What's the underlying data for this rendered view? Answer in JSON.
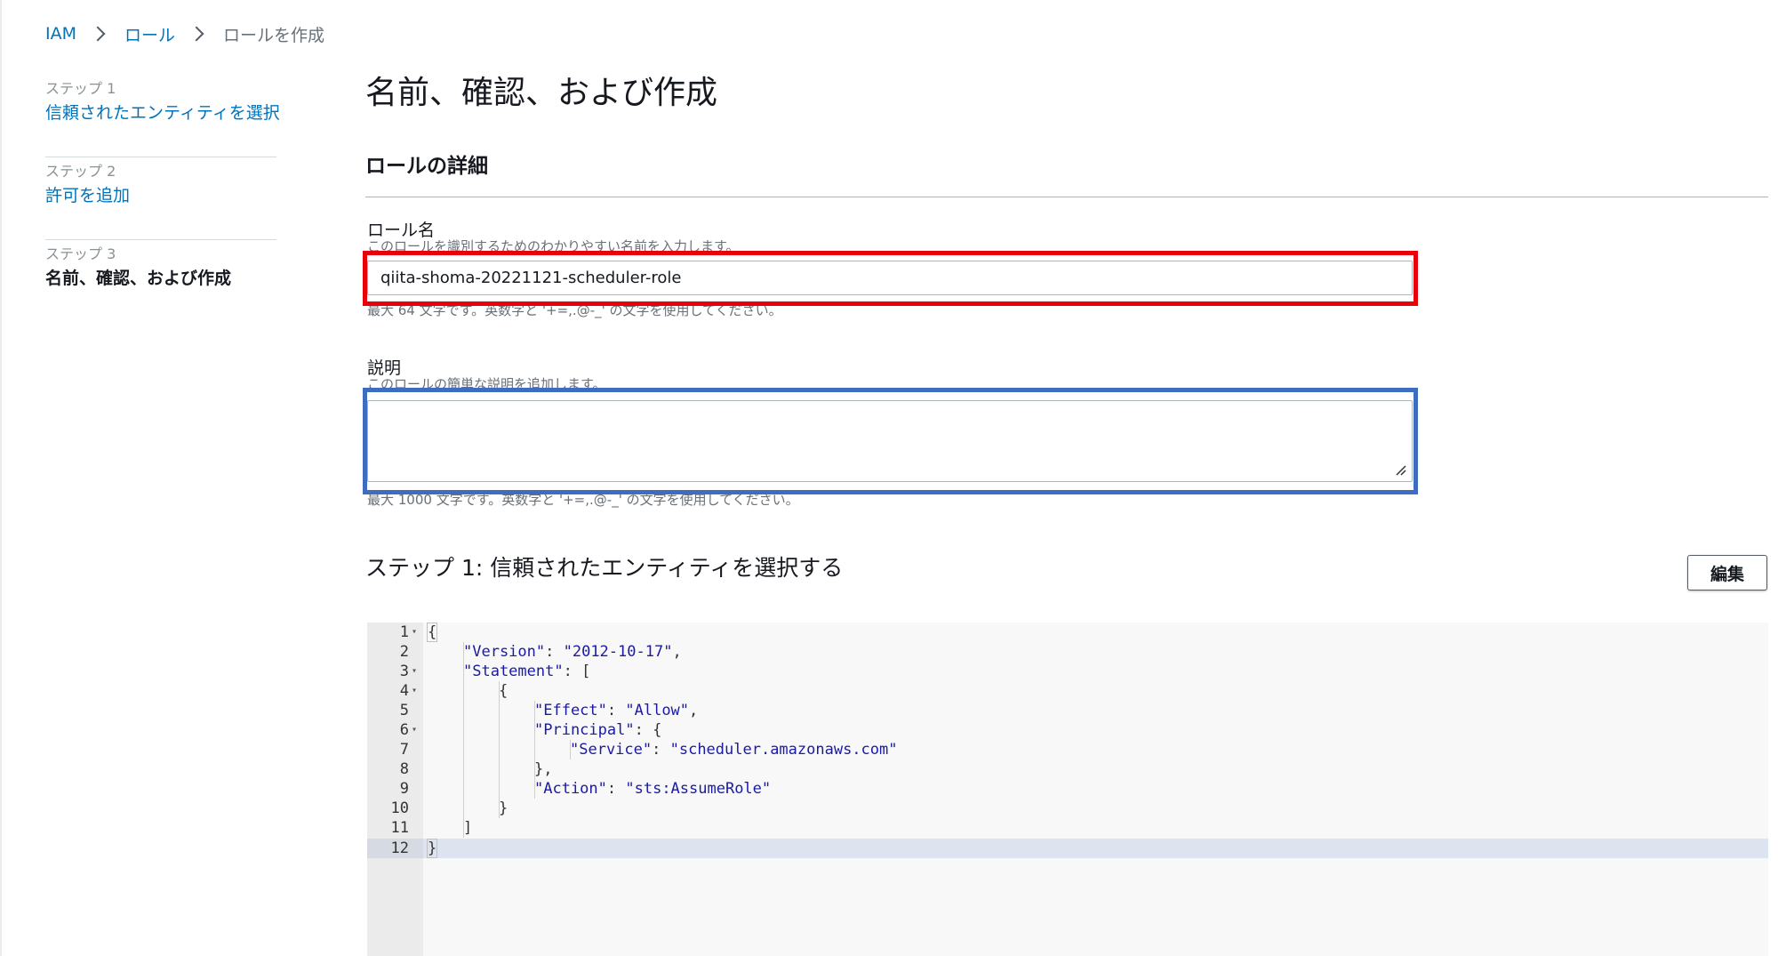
{
  "breadcrumb": {
    "items": [
      {
        "label": "IAM"
      },
      {
        "label": "ロール"
      },
      {
        "label": "ロールを作成"
      }
    ]
  },
  "steps": [
    {
      "number": "ステップ 1",
      "title": "信頼されたエンティティを選択"
    },
    {
      "number": "ステップ 2",
      "title": "許可を追加"
    },
    {
      "number": "ステップ 3",
      "title": "名前、確認、および作成"
    }
  ],
  "page": {
    "title": "名前、確認、および作成",
    "section_title": "ロールの詳細"
  },
  "role_name": {
    "label": "ロール名",
    "description": "このロールを識別するためのわかりやすい名前を入力します。",
    "value": "qiita-shoma-20221121-scheduler-role",
    "constraint": "最大 64 文字です。英数字と '+=,.@-_' の文字を使用してください。"
  },
  "description_field": {
    "label": "説明",
    "description": "このロールの簡単な説明を追加します。",
    "value": "",
    "constraint": "最大 1000 文字です。英数字と '+=,.@-_' の文字を使用してください。"
  },
  "step1_section": {
    "heading": "ステップ 1: 信頼されたエンティティを選択する",
    "edit_label": "編集"
  },
  "code_editor": {
    "lines": [
      {
        "num": "1",
        "fold": true
      },
      {
        "num": "2",
        "fold": false,
        "key": "\"Version\"",
        "sep": ": ",
        "val": "\"2012-10-17\"",
        "tail": ","
      },
      {
        "num": "3",
        "fold": true,
        "key": "\"Statement\"",
        "sep": ": [",
        "val": "",
        "tail": ""
      },
      {
        "num": "4",
        "fold": true,
        "text": "{"
      },
      {
        "num": "5",
        "fold": false,
        "key": "\"Effect\"",
        "sep": ": ",
        "val": "\"Allow\"",
        "tail": ","
      },
      {
        "num": "6",
        "fold": true,
        "key": "\"Principal\"",
        "sep": ": {",
        "val": "",
        "tail": ""
      },
      {
        "num": "7",
        "fold": false,
        "key": "\"Service\"",
        "sep": ": ",
        "val": "\"scheduler.amazonaws.com\"",
        "tail": ""
      },
      {
        "num": "8",
        "fold": false,
        "text": "},"
      },
      {
        "num": "9",
        "fold": false,
        "key": "\"Action\"",
        "sep": ": ",
        "val": "\"sts:AssumeRole\"",
        "tail": ""
      },
      {
        "num": "10",
        "fold": false,
        "text": "}"
      },
      {
        "num": "11",
        "fold": false,
        "text": "]"
      },
      {
        "num": "12",
        "fold": false
      }
    ],
    "open_brace": "{",
    "close_brace": "}"
  },
  "colors": {
    "link": "#0073bb",
    "highlight_red": "#e8000b",
    "highlight_blue": "#3e6cc0",
    "json_string": "#1a1aa6"
  }
}
